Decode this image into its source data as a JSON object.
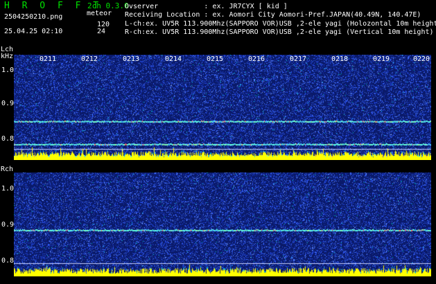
{
  "header": {
    "app_title": "H R O F F T",
    "version": "2ch 0.3.0",
    "file_name": "2504250210.png",
    "timestamp": "25.04.25 02:10",
    "meteor_label": "meteor",
    "meteor_count_l": "120",
    "meteor_count_r": "24",
    "observer_line": "Ovserver           : ex. JR7CYX [ kid ]",
    "location_line": "Receiving Location : ex. Aomori City Aomori-Pref.JAPAN(40.49N, 140.47E)",
    "lch_line": "L-ch:ex. UV5R 113.900Mhz(SAPPORO VOR)USB ,2-ele yagi (Holozontal 10m height)",
    "rch_line": "R-ch:ex. UV5R 113.900Mhz(SAPPORO VOR)USB ,2-ele yagi (Vertical 10m height)"
  },
  "panels": {
    "lch_label": "Lch",
    "khz_label": "kHz",
    "rch_label": "Rch",
    "time_ticks": [
      "0211",
      "0212",
      "0213",
      "0214",
      "0215",
      "0216",
      "0217",
      "0218",
      "0219",
      "0220"
    ],
    "lch_yticks": [
      "1.0",
      "0.9",
      "0.8"
    ],
    "rch_yticks": [
      "1.0",
      "0.9",
      "0.8"
    ]
  },
  "chart_data": [
    {
      "type": "heatmap",
      "name": "Lch",
      "x_ticks": [
        "0211",
        "0212",
        "0213",
        "0214",
        "0215",
        "0216",
        "0217",
        "0218",
        "0219",
        "0220"
      ],
      "y_ticks": [
        1.0,
        0.9,
        0.8
      ],
      "ylim": [
        0.77,
        1.05
      ],
      "signal_lines_khz": [
        0.873,
        0.812,
        0.781
      ],
      "reference_lines_khz": [
        0.8
      ],
      "colors": {
        "background": "#0a1a6a",
        "noise": "#3060ff",
        "line": "#60ffe0",
        "meteor_bar": "#ffff00"
      }
    },
    {
      "type": "heatmap",
      "name": "Rch",
      "x_ticks": [
        "0211",
        "0212",
        "0213",
        "0214",
        "0215",
        "0216",
        "0217",
        "0218",
        "0219",
        "0220"
      ],
      "y_ticks": [
        1.0,
        0.9,
        0.8
      ],
      "ylim": [
        0.77,
        1.05
      ],
      "signal_lines_khz": [
        0.895
      ],
      "reference_lines_khz": [
        0.805
      ],
      "colors": {
        "background": "#0a1a6a",
        "noise": "#3060ff",
        "line": "#60ffe0",
        "meteor_bar": "#ffff00"
      }
    }
  ]
}
